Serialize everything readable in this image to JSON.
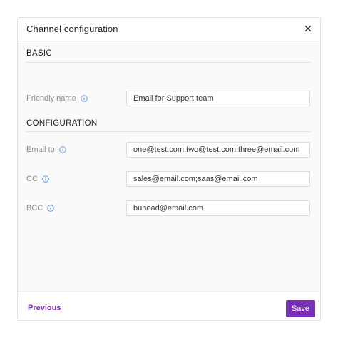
{
  "dialog": {
    "title": "Channel configuration",
    "close_icon": "close-icon"
  },
  "sections": {
    "basic": {
      "title": "BASIC",
      "friendly_name": {
        "label": "Friendly name",
        "value": "Email for Support team"
      }
    },
    "configuration": {
      "title": "CONFIGURATION",
      "email_to": {
        "label": "Email to",
        "value": "one@test.com;two@test.com;three@email.com"
      },
      "cc": {
        "label": "CC",
        "value": "sales@email.com;saas@email.com"
      },
      "bcc": {
        "label": "BCC",
        "value": "buhead@email.com"
      }
    }
  },
  "footer": {
    "previous_label": "Previous",
    "save_label": "Save"
  },
  "colors": {
    "accent": "#7b2fb5",
    "info_icon": "#5b8fd6"
  },
  "icons": {
    "info": "info-icon",
    "close": "close-icon"
  }
}
